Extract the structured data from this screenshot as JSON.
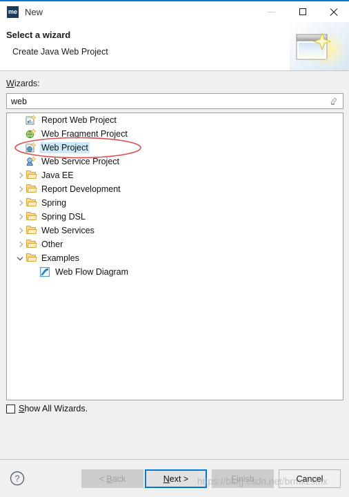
{
  "window": {
    "icon_label": "me",
    "title": "New",
    "controls": {
      "minimize": "minimize-icon",
      "maximize": "maximize-icon",
      "close": "close-icon"
    }
  },
  "header": {
    "title": "Select a wizard",
    "subtitle": "Create Java Web Project",
    "art_icon": "new-wizard-sparkle-icon"
  },
  "wizards_label": "Wizards:",
  "search": {
    "value": "web",
    "placeholder": "",
    "clear_icon": "eraser-icon"
  },
  "tree": {
    "items": [
      {
        "label": "Report Web Project",
        "icon": "report-web-project-icon",
        "indent": "leaf",
        "arrow": "none",
        "selected": false
      },
      {
        "label": "Web Fragment Project",
        "icon": "web-fragment-project-icon",
        "indent": "leaf",
        "arrow": "none",
        "selected": false
      },
      {
        "label": "Web Project",
        "icon": "web-project-icon",
        "indent": "leaf",
        "arrow": "none",
        "selected": true
      },
      {
        "label": "Web Service Project",
        "icon": "web-service-project-icon",
        "indent": "leaf",
        "arrow": "none",
        "selected": false
      },
      {
        "label": "Java EE",
        "icon": "folder-icon",
        "indent": "root",
        "arrow": "collapsed",
        "selected": false
      },
      {
        "label": "Report Development",
        "icon": "folder-icon",
        "indent": "root",
        "arrow": "collapsed",
        "selected": false
      },
      {
        "label": "Spring",
        "icon": "folder-icon",
        "indent": "root",
        "arrow": "collapsed",
        "selected": false
      },
      {
        "label": "Spring DSL",
        "icon": "folder-icon",
        "indent": "root",
        "arrow": "collapsed",
        "selected": false
      },
      {
        "label": "Web Services",
        "icon": "folder-icon",
        "indent": "root",
        "arrow": "collapsed",
        "selected": false
      },
      {
        "label": "Other",
        "icon": "folder-icon",
        "indent": "root",
        "arrow": "collapsed",
        "selected": false
      },
      {
        "label": "Examples",
        "icon": "folder-icon",
        "indent": "root",
        "arrow": "expanded",
        "selected": false
      },
      {
        "label": "Web Flow Diagram",
        "icon": "web-flow-diagram-icon",
        "indent": "sub",
        "arrow": "none",
        "selected": false
      }
    ]
  },
  "show_all": {
    "label_prefix": "",
    "label_underline": "S",
    "label_rest": "how All Wizards.",
    "checked": false
  },
  "footer": {
    "help_icon": "help-icon",
    "buttons": [
      {
        "id": "back",
        "label_pre": "< ",
        "label_u": "B",
        "label_post": "ack",
        "state": "disabled"
      },
      {
        "id": "next",
        "label_pre": "",
        "label_u": "N",
        "label_post": "ext >",
        "state": "focused"
      },
      {
        "id": "finish",
        "label_pre": "",
        "label_u": "F",
        "label_post": "inish",
        "state": "disabled"
      },
      {
        "id": "cancel",
        "label_pre": "",
        "label_u": "",
        "label_post": "Cancel",
        "state": "normal"
      }
    ]
  },
  "watermark": "https://blog.csdn.net/brmxzsmx",
  "colors": {
    "accent": "#0078d7",
    "selection": "#cde8f7",
    "dialog_bg": "#f0f0f0",
    "annotation_red": "#e04a4a"
  }
}
